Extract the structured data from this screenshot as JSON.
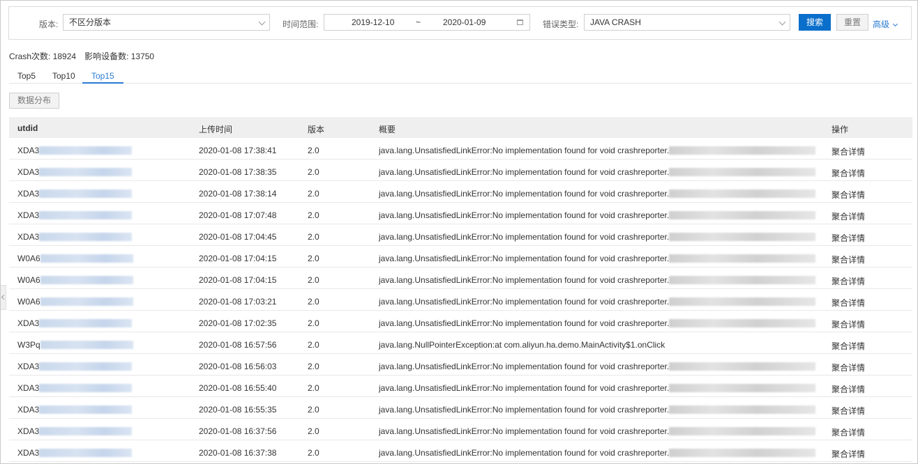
{
  "filters": {
    "version_label": "版本:",
    "version_value": "不区分版本",
    "time_label": "时间范围:",
    "date_start": "2019-12-10",
    "date_sep": "~",
    "date_end": "2020-01-09",
    "error_type_label": "错误类型:",
    "error_type_value": "JAVA CRASH",
    "search_label": "搜索",
    "reset_label": "重置",
    "advanced_label": "高级"
  },
  "stats": {
    "crash_count_text": "Crash次数: 18924",
    "affected_devices_text": "影响设备数: 13750"
  },
  "tabs": [
    {
      "label": "Top5",
      "active": false
    },
    {
      "label": "Top10",
      "active": false
    },
    {
      "label": "Top15",
      "active": true
    }
  ],
  "data_distribution_label": "数据分布",
  "table": {
    "columns": [
      "utdid",
      "上传时间",
      "版本",
      "概要",
      "操作"
    ],
    "rows": [
      {
        "utdid_prefix": "XDA3",
        "time": "2020-01-08 17:38:41",
        "version": "2.0",
        "summary": "java.lang.UnsatisfiedLinkError:No implementation found for void crashreporter.",
        "action": "聚合详情"
      },
      {
        "utdid_prefix": "XDA3",
        "time": "2020-01-08 17:38:35",
        "version": "2.0",
        "summary": "java.lang.UnsatisfiedLinkError:No implementation found for void crashreporter.",
        "action": "聚合详情"
      },
      {
        "utdid_prefix": "XDA3",
        "time": "2020-01-08 17:38:14",
        "version": "2.0",
        "summary": "java.lang.UnsatisfiedLinkError:No implementation found for void crashreporter.",
        "action": "聚合详情"
      },
      {
        "utdid_prefix": "XDA3",
        "time": "2020-01-08 17:07:48",
        "version": "2.0",
        "summary": "java.lang.UnsatisfiedLinkError:No implementation found for void crashreporter.",
        "action": "聚合详情"
      },
      {
        "utdid_prefix": "XDA3",
        "time": "2020-01-08 17:04:45",
        "version": "2.0",
        "summary": "java.lang.UnsatisfiedLinkError:No implementation found for void crashreporter.",
        "action": "聚合详情"
      },
      {
        "utdid_prefix": "W0A6",
        "time": "2020-01-08 17:04:15",
        "version": "2.0",
        "summary": "java.lang.UnsatisfiedLinkError:No implementation found for void crashreporter.",
        "action": "聚合详情"
      },
      {
        "utdid_prefix": "W0A6",
        "time": "2020-01-08 17:04:15",
        "version": "2.0",
        "summary": "java.lang.UnsatisfiedLinkError:No implementation found for void crashreporter.",
        "action": "聚合详情"
      },
      {
        "utdid_prefix": "W0A6",
        "time": "2020-01-08 17:03:21",
        "version": "2.0",
        "summary": "java.lang.UnsatisfiedLinkError:No implementation found for void crashreporter.",
        "action": "聚合详情"
      },
      {
        "utdid_prefix": "XDA3",
        "time": "2020-01-08 17:02:35",
        "version": "2.0",
        "summary": "java.lang.UnsatisfiedLinkError:No implementation found for void crashreporter.",
        "action": "聚合详情"
      },
      {
        "utdid_prefix": "W3Pq",
        "time": "2020-01-08 16:57:56",
        "version": "2.0",
        "summary": "java.lang.NullPointerException:at com.aliyun.ha.demo.MainActivity$1.onClick",
        "action": "聚合详情"
      },
      {
        "utdid_prefix": "XDA3",
        "time": "2020-01-08 16:56:03",
        "version": "2.0",
        "summary": "java.lang.UnsatisfiedLinkError:No implementation found for void crashreporter.",
        "action": "聚合详情"
      },
      {
        "utdid_prefix": "XDA3",
        "time": "2020-01-08 16:55:40",
        "version": "2.0",
        "summary": "java.lang.UnsatisfiedLinkError:No implementation found for void crashreporter.",
        "action": "聚合详情"
      },
      {
        "utdid_prefix": "XDA3",
        "time": "2020-01-08 16:55:35",
        "version": "2.0",
        "summary": "java.lang.UnsatisfiedLinkError:No implementation found for void crashreporter.",
        "action": "聚合详情"
      },
      {
        "utdid_prefix": "XDA3",
        "time": "2020-01-08 16:37:56",
        "version": "2.0",
        "summary": "java.lang.UnsatisfiedLinkError:No implementation found for void crashreporter.",
        "action": "聚合详情"
      },
      {
        "utdid_prefix": "XDA3",
        "time": "2020-01-08 16:37:38",
        "version": "2.0",
        "summary": "java.lang.UnsatisfiedLinkError:No implementation found for void crashreporter.",
        "action": "聚合详情"
      }
    ]
  }
}
